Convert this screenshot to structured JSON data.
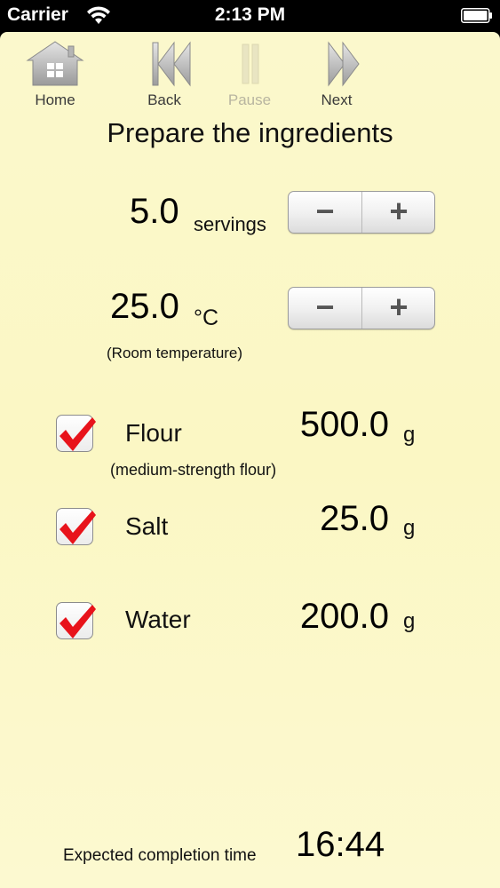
{
  "status_bar": {
    "carrier": "Carrier",
    "time": "2:13 PM"
  },
  "toolbar": {
    "home_label": "Home",
    "back_label": "Back",
    "pause_label": "Pause",
    "next_label": "Next"
  },
  "title": "Prepare the ingredients",
  "servings": {
    "value": "5.0",
    "unit": "servings",
    "minus": "−",
    "plus": "+"
  },
  "temperature": {
    "value": "25.0",
    "unit": "°C",
    "note": "(Room temperature)",
    "minus": "−",
    "plus": "+"
  },
  "ingredients": [
    {
      "name": "Flour",
      "amount": "500.0",
      "unit": "g",
      "note": "(medium-strength flour)",
      "checked": true
    },
    {
      "name": "Salt",
      "amount": "25.0",
      "unit": "g",
      "checked": true
    },
    {
      "name": "Water",
      "amount": "200.0",
      "unit": "g",
      "checked": true
    }
  ],
  "footer": {
    "label": "Expected completion time",
    "time": "16:44"
  },
  "colors": {
    "background": "#fbf8cc",
    "check_mark": "#e8131b"
  }
}
